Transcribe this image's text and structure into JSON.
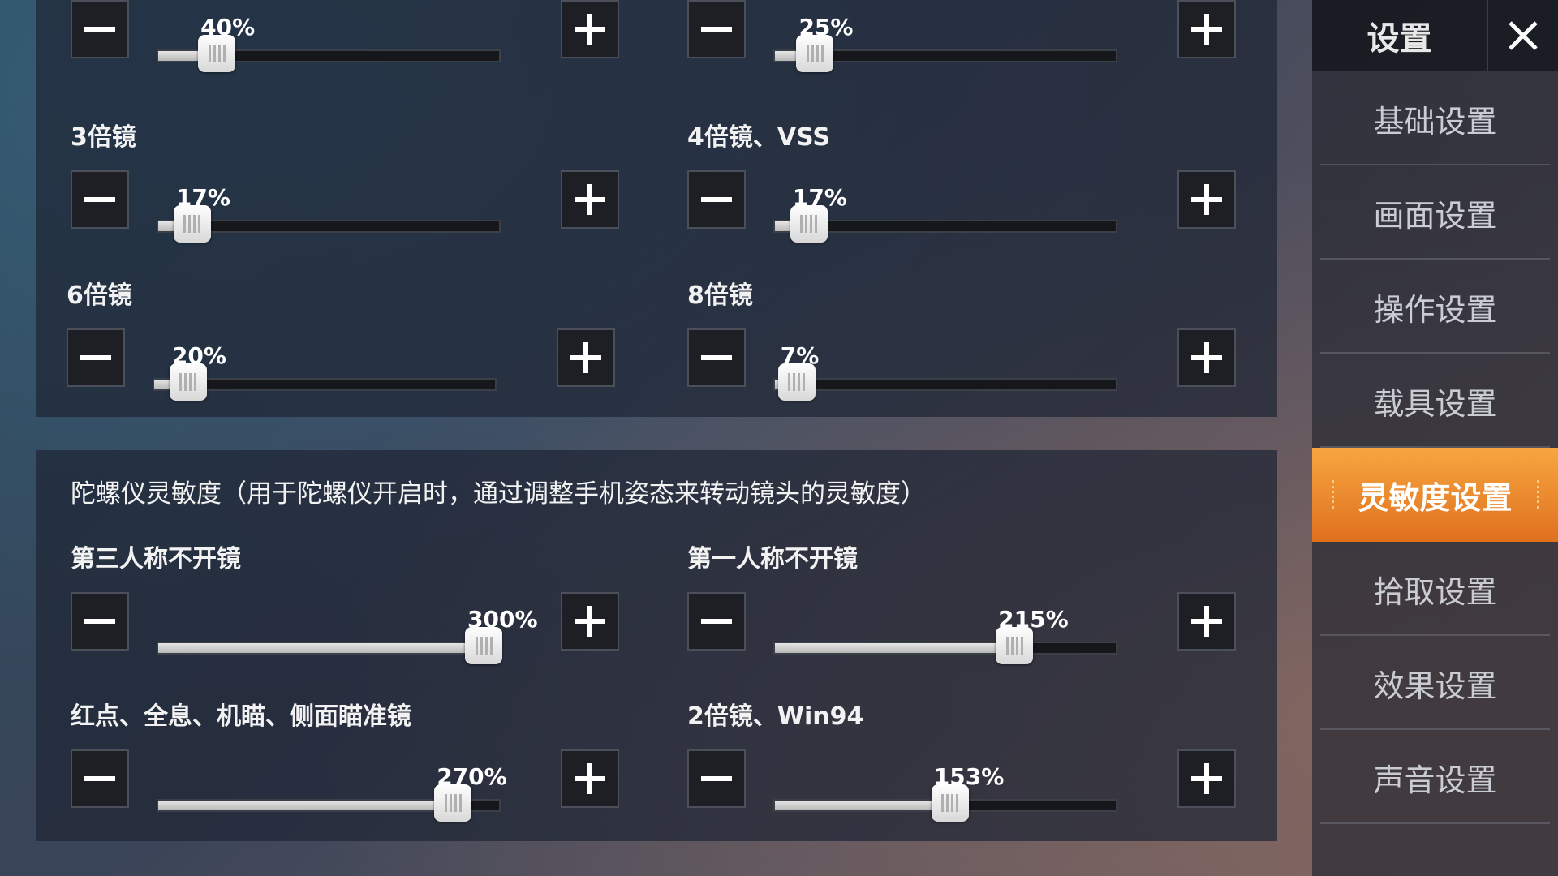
{
  "scope_settings": [
    {
      "id": "scope-top-left",
      "label": "",
      "value_text": "40%",
      "level": 0.13
    },
    {
      "id": "scope-top-right",
      "label": "",
      "value_text": "25%",
      "level": 0.07
    },
    {
      "id": "scope-3x",
      "label": "3倍镜",
      "value_text": "17%",
      "level": 0.05
    },
    {
      "id": "scope-4x-vss",
      "label": "4倍镜、VSS",
      "value_text": "17%",
      "level": 0.05
    },
    {
      "id": "scope-6x",
      "label": "6倍镜",
      "value_text": "20%",
      "level": 0.05
    },
    {
      "id": "scope-8x",
      "label": "8倍镜",
      "value_text": "7%",
      "level": 0.01
    }
  ],
  "gyro": {
    "title": "陀螺仪灵敏度（用于陀螺仪开启时，通过调整手机姿态来转动镜头的灵敏度）",
    "settings": [
      {
        "id": "gyro-tpp-no-scope",
        "label": "第三人称不开镜",
        "value_text": "300%",
        "level": 1.0
      },
      {
        "id": "gyro-fpp-no-scope",
        "label": "第一人称不开镜",
        "value_text": "215%",
        "level": 0.72
      },
      {
        "id": "gyro-reddot-holo",
        "label": "红点、全息、机瞄、侧面瞄准镜",
        "value_text": "270%",
        "level": 0.9
      },
      {
        "id": "gyro-2x-win94",
        "label": "2倍镜、Win94",
        "value_text": "153%",
        "level": 0.51
      }
    ]
  },
  "sidebar": {
    "title": "设置",
    "items": [
      {
        "label": "基础设置",
        "active": false
      },
      {
        "label": "画面设置",
        "active": false
      },
      {
        "label": "操作设置",
        "active": false
      },
      {
        "label": "载具设置",
        "active": false
      },
      {
        "label": "灵敏度设置",
        "active": true
      },
      {
        "label": "拾取设置",
        "active": false
      },
      {
        "label": "效果设置",
        "active": false
      },
      {
        "label": "声音设置",
        "active": false
      }
    ]
  },
  "icons": {
    "minus": "minus-icon",
    "plus": "plus-icon",
    "close": "close-icon"
  },
  "colors": {
    "active_menu": "#f08a2c",
    "panel": "#1e2634"
  }
}
